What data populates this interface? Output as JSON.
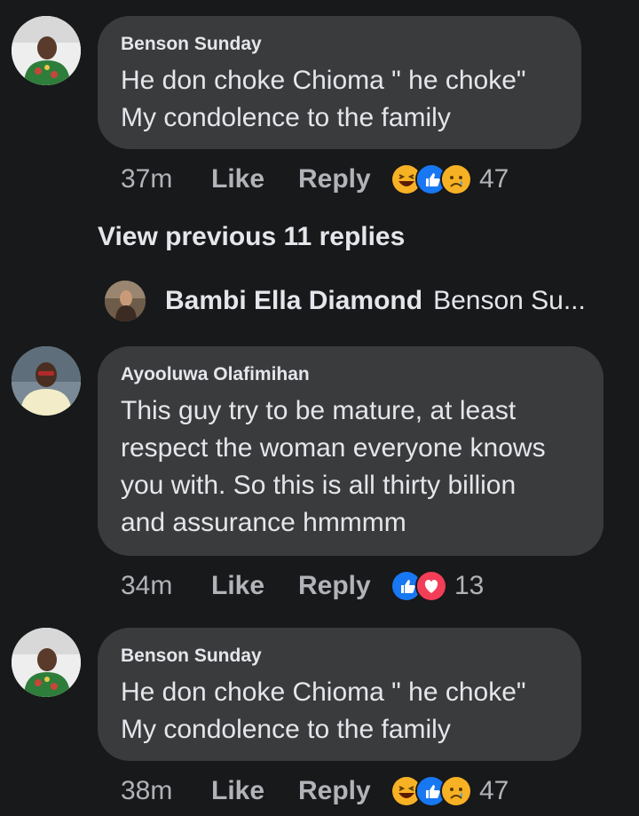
{
  "comments": [
    {
      "author": "Benson Sunday",
      "text": "He don choke Chioma \" he choke\"\nMy condolence to the family",
      "time": "37m",
      "like_label": "Like",
      "reply_label": "Reply",
      "reactions": [
        "haha",
        "like",
        "sad"
      ],
      "reaction_count": "47"
    },
    {
      "author": "Ayooluwa Olafimihan",
      "text": "This guy try to be mature, at least\nrespect the woman everyone knows\nyou with. So this is all thirty billion\nand assurance hmmmm",
      "time": "34m",
      "like_label": "Like",
      "reply_label": "Reply",
      "reactions": [
        "like",
        "love"
      ],
      "reaction_count": "13"
    },
    {
      "author": "Benson Sunday",
      "text": "He don choke Chioma \" he choke\"\nMy condolence to the family",
      "time": "38m",
      "like_label": "Like",
      "reply_label": "Reply",
      "reactions": [
        "haha",
        "like",
        "sad"
      ],
      "reaction_count": "47"
    }
  ],
  "view_previous": "View previous 11 replies",
  "collapsed_reply": {
    "author": "Bambi Ella Diamond",
    "preview": "Benson Su..."
  },
  "colors": {
    "background": "#18191a",
    "bubble": "#3a3b3c",
    "text": "#e4e6eb",
    "muted": "#b0b3b8",
    "like_blue": "#1877f2",
    "love_red": "#f33e58",
    "haha_yellow": "#f7b125"
  }
}
